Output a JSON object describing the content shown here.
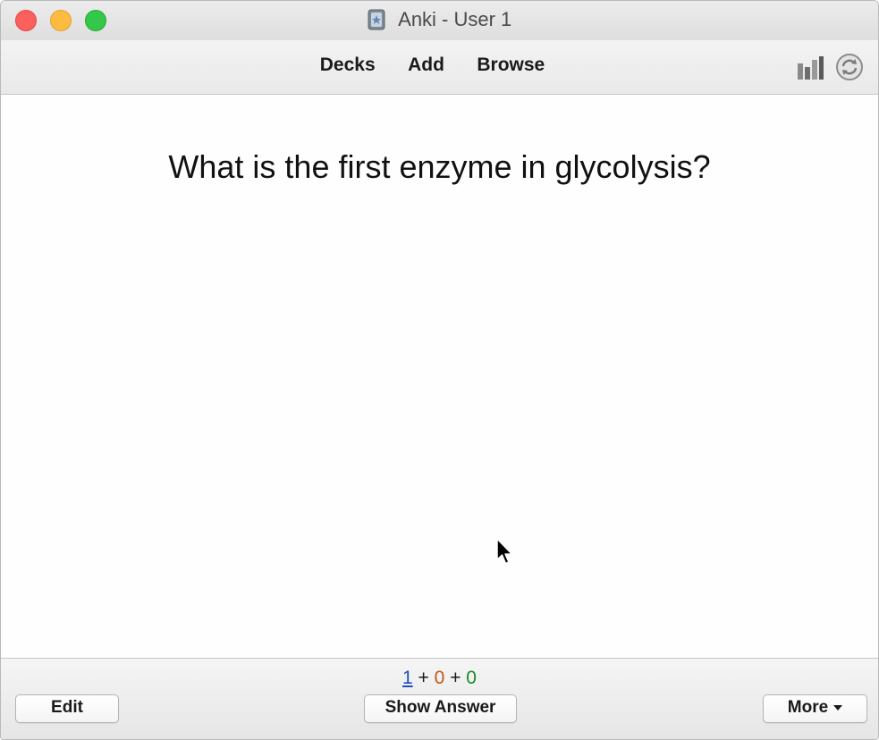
{
  "window": {
    "title": "Anki - User 1"
  },
  "toolbar": {
    "nav": [
      {
        "label": "Decks"
      },
      {
        "label": "Add"
      },
      {
        "label": "Browse"
      }
    ],
    "icons": [
      "stats-icon",
      "sync-icon"
    ]
  },
  "card": {
    "question": "What is the first enzyme in glycolysis?"
  },
  "bottombar": {
    "counts": {
      "new": "1",
      "learning": "0",
      "review": "0",
      "separator": "+"
    },
    "edit_label": "Edit",
    "show_answer_label": "Show Answer",
    "more_label": "More"
  },
  "colors": {
    "new_count": "#1f4fbf",
    "learning_count": "#c2561a",
    "review_count": "#1b8a2a",
    "close": "#fc605c",
    "minimize": "#fdbc40",
    "zoom": "#34c84a"
  }
}
